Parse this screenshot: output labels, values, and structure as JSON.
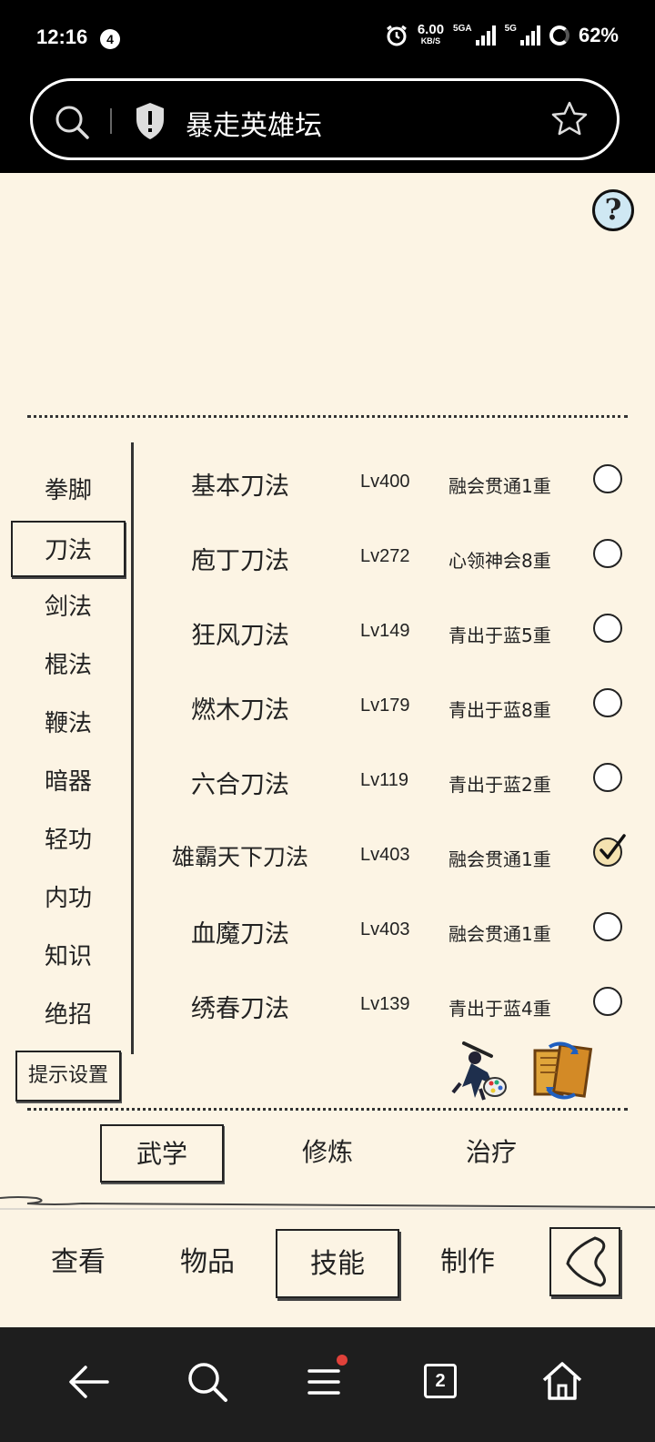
{
  "status": {
    "time": "12:16",
    "notif_count": "4",
    "speed_value": "6.00",
    "speed_unit": "KB/S",
    "sim1": "5GA",
    "sim2": "5G",
    "battery": "62%"
  },
  "browser": {
    "url_title": "暴走英雄坛",
    "tab_count": "2",
    "icons": [
      "search-icon",
      "shield-icon",
      "star-icon",
      "back-arrow-icon",
      "search-icon",
      "menu-icon",
      "tabs-icon",
      "home-icon"
    ]
  },
  "game": {
    "help_label": "?",
    "categories": [
      {
        "label": "拳脚",
        "selected": false
      },
      {
        "label": "刀法",
        "selected": true
      },
      {
        "label": "剑法",
        "selected": false
      },
      {
        "label": "棍法",
        "selected": false
      },
      {
        "label": "鞭法",
        "selected": false
      },
      {
        "label": "暗器",
        "selected": false
      },
      {
        "label": "轻功",
        "selected": false
      },
      {
        "label": "内功",
        "selected": false
      },
      {
        "label": "知识",
        "selected": false
      },
      {
        "label": "绝招",
        "selected": false
      }
    ],
    "hint_settings": "提示设置",
    "skills": [
      {
        "name": "基本刀法",
        "level": "Lv400",
        "rank": "融会贯通1重",
        "equipped": false
      },
      {
        "name": "庖丁刀法",
        "level": "Lv272",
        "rank": "心领神会8重",
        "equipped": false
      },
      {
        "name": "狂风刀法",
        "level": "Lv149",
        "rank": "青出于蓝5重",
        "equipped": false
      },
      {
        "name": "燃木刀法",
        "level": "Lv179",
        "rank": "青出于蓝8重",
        "equipped": false
      },
      {
        "name": "六合刀法",
        "level": "Lv119",
        "rank": "青出于蓝2重",
        "equipped": false
      },
      {
        "name": "雄霸天下刀法",
        "level": "Lv403",
        "rank": "融会贯通1重",
        "equipped": true
      },
      {
        "name": "血魔刀法",
        "level": "Lv403",
        "rank": "融会贯通1重",
        "equipped": false
      },
      {
        "name": "绣春刀法",
        "level": "Lv139",
        "rank": "青出于蓝4重",
        "equipped": false
      }
    ],
    "tabs": [
      {
        "label": "武学",
        "selected": true
      },
      {
        "label": "修炼",
        "selected": false
      },
      {
        "label": "治疗",
        "selected": false
      }
    ],
    "nav": [
      {
        "label": "查看",
        "selected": false
      },
      {
        "label": "物品",
        "selected": false
      },
      {
        "label": "技能",
        "selected": true
      },
      {
        "label": "制作",
        "selected": false
      }
    ]
  }
}
